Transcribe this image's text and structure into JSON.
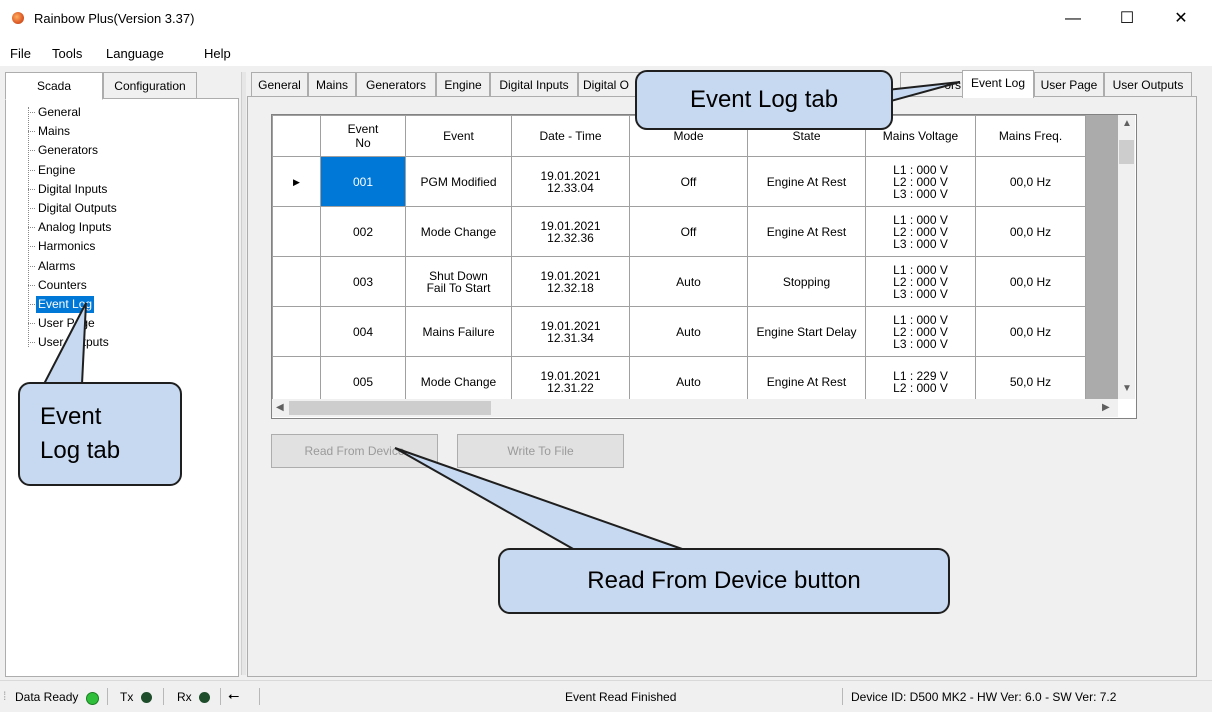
{
  "window": {
    "title": "Rainbow Plus(Version 3.37)",
    "controls": {
      "minimize": "—",
      "maximize": "☐",
      "close": "✕"
    }
  },
  "menu": [
    "File",
    "Tools",
    "Language",
    "Help"
  ],
  "left_tabs": [
    "Scada",
    "Configuration"
  ],
  "tree": [
    "General",
    "Mains",
    "Generators",
    "Engine",
    "Digital Inputs",
    "Digital Outputs",
    "Analog Inputs",
    "Harmonics",
    "Alarms",
    "Counters",
    "Event Log",
    "User Page",
    "User Outputs"
  ],
  "right_tabs": [
    "General",
    "Mains",
    "Generators",
    "Engine",
    "Digital Inputs",
    "Digital O",
    "ors",
    "Event Log",
    "User Page",
    "User Outputs"
  ],
  "grid": {
    "columns": [
      "Event No",
      "Event",
      "Date - Time",
      "Mode",
      "State",
      "Mains Voltage",
      "Mains Freq."
    ],
    "rows": [
      {
        "no": "001",
        "event": "PGM Modified",
        "date": "19.01.2021",
        "time": "12.33.04",
        "mode": "Off",
        "state": "Engine At Rest",
        "v1": "L1 : 000 V",
        "v2": "L2 : 000 V",
        "v3": "L3 : 000 V",
        "freq": "00,0 Hz"
      },
      {
        "no": "002",
        "event": "Mode Change",
        "date": "19.01.2021",
        "time": "12.32.36",
        "mode": "Off",
        "state": "Engine At Rest",
        "v1": "L1 : 000 V",
        "v2": "L2 : 000 V",
        "v3": "L3 : 000 V",
        "freq": "00,0 Hz"
      },
      {
        "no": "003",
        "event": "Shut Down",
        "event2": "Fail To Start",
        "date": "19.01.2021",
        "time": "12.32.18",
        "mode": "Auto",
        "state": "Stopping",
        "v1": "L1 : 000 V",
        "v2": "L2 : 000 V",
        "v3": "L3 : 000 V",
        "freq": "00,0 Hz"
      },
      {
        "no": "004",
        "event": "Mains Failure",
        "date": "19.01.2021",
        "time": "12.31.34",
        "mode": "Auto",
        "state": "Engine Start Delay",
        "v1": "L1 : 000 V",
        "v2": "L2 : 000 V",
        "v3": "L3 : 000 V",
        "freq": "00,0 Hz"
      },
      {
        "no": "005",
        "event": "Mode Change",
        "date": "19.01.2021",
        "time": "12.31.22",
        "mode": "Auto",
        "state": "Engine At Rest",
        "v1": "L1 : 229 V",
        "v2": "L2 : 000 V",
        "v3": "",
        "freq": "50,0 Hz"
      }
    ]
  },
  "buttons": {
    "read": "Read From Device",
    "write": "Write To File"
  },
  "status": {
    "data_ready": "Data Ready",
    "tx": "Tx",
    "rx": "Rx",
    "usb_icon": "usb-icon",
    "message": "Event Read Finished",
    "device": "Device ID: D500 MK2 - HW Ver: 6.0 - SW Ver: 7.2"
  },
  "callouts": {
    "top": "Event Log tab",
    "left_line1": "Event",
    "left_line2": "Log tab",
    "bottom": "Read From Device button"
  },
  "colors": {
    "selection": "#0078d7",
    "callout_fill": "#c6d9f1",
    "led_green": "#2fbf3a",
    "led_dark": "#1e4d2b"
  }
}
